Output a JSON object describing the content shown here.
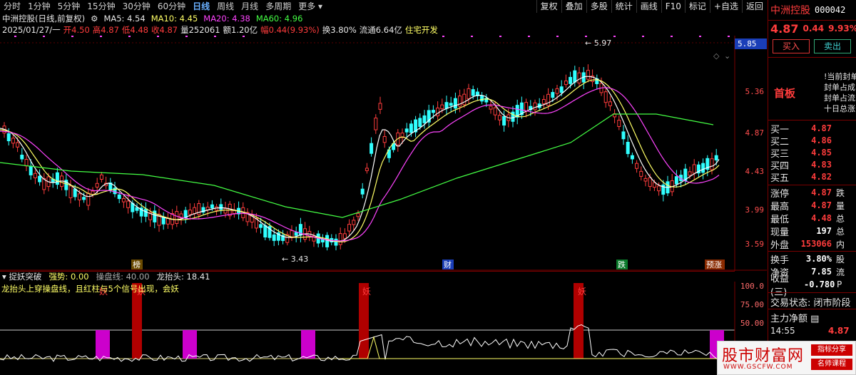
{
  "toolbar": {
    "periods": [
      "分时",
      "1分钟",
      "5分钟",
      "15分钟",
      "30分钟",
      "60分钟",
      "日线",
      "周线",
      "月线",
      "多周期",
      "更多"
    ],
    "active_period": "日线",
    "tools": [
      "复权",
      "叠加",
      "多股",
      "统计",
      "画线",
      "F10",
      "标记",
      "+自选",
      "返回"
    ]
  },
  "title_bar": {
    "stock_name": "中洲控股(日线,前复权)",
    "ma5": "MA5: 4.54",
    "ma10": "MA10: 4.45",
    "ma20": "MA20: 4.38",
    "ma60": "MA60: 4.96"
  },
  "ohlc": {
    "date": "2025/01/27/一",
    "open": "开4.50",
    "high": "高4.87",
    "low": "低4.48",
    "close": "收4.87",
    "vol": "量252061",
    "amount": "额1.20亿",
    "change": "幅0.44(9.93%)",
    "turnover": "换3.80%",
    "float_mv": "流通6.64亿",
    "sector": "住宅开发"
  },
  "price_axis": {
    "labels": [
      "5.85",
      "5.36",
      "4.87",
      "4.43",
      "3.99",
      "3.59"
    ],
    "current": "5.85",
    "high_mark": "5.97",
    "low_mark": "3.43"
  },
  "markers": {
    "m1": "榜",
    "m2": "财",
    "m3": "跌",
    "m4": "预涨"
  },
  "indicator": {
    "name": "捉妖突破",
    "strength": "强势: 0.00",
    "control": "操盘线: 40.00",
    "dragon": "龙抬头: 18.41",
    "desc": "龙抬头上穿操盘线，且红柱与5个信号出现，会妖",
    "signal": "妖",
    "axis": [
      "100.0",
      "75.00",
      "50.00"
    ]
  },
  "side": {
    "name": "中洲控股",
    "code": "000042",
    "price": "4.87",
    "change": "0.44",
    "pct": "9.93%",
    "buy_btn": "买入",
    "sell_btn": "卖出",
    "board": "首板",
    "notes": [
      "!当前封单",
      "封单占成",
      "封单占流",
      "十日总涨"
    ],
    "bids": [
      {
        "label": "买一",
        "price": "4.87"
      },
      {
        "label": "买二",
        "price": "4.86"
      },
      {
        "label": "买三",
        "price": "4.85"
      },
      {
        "label": "买四",
        "price": "4.83"
      },
      {
        "label": "买五",
        "price": "4.82"
      }
    ],
    "stats": [
      {
        "label": "涨停",
        "val": "4.87",
        "extra": "跌"
      },
      {
        "label": "最高",
        "val": "4.87",
        "extra": "量"
      },
      {
        "label": "最低",
        "val": "4.48",
        "extra": "总"
      },
      {
        "label": "现量",
        "val": "197",
        "extra": "总"
      },
      {
        "label": "外盘",
        "val": "153066",
        "extra": "内"
      }
    ],
    "stats2": [
      {
        "label": "换手",
        "val": "3.80%",
        "extra": "股"
      },
      {
        "label": "净资",
        "val": "7.85",
        "extra": "流"
      },
      {
        "label": "收益(三)",
        "val": "-0.780",
        "extra": "P"
      }
    ],
    "trade_status": "交易状态: 闭市阶段",
    "main_flow": "主力净额",
    "time": "14:55",
    "time_price": "4.87"
  },
  "watermark": {
    "site": "股市财富网",
    "url": "WWW.GSCFW.COM",
    "tag1": "指标分享",
    "tag2": "名师课程"
  },
  "colors": {
    "up": "#ff3c3c",
    "down": "#30ffff",
    "ma5": "#ffffff",
    "ma10": "#ffff66",
    "ma20": "#ff44ff",
    "ma60": "#44ff44",
    "accent": "#1a3eb8"
  }
}
